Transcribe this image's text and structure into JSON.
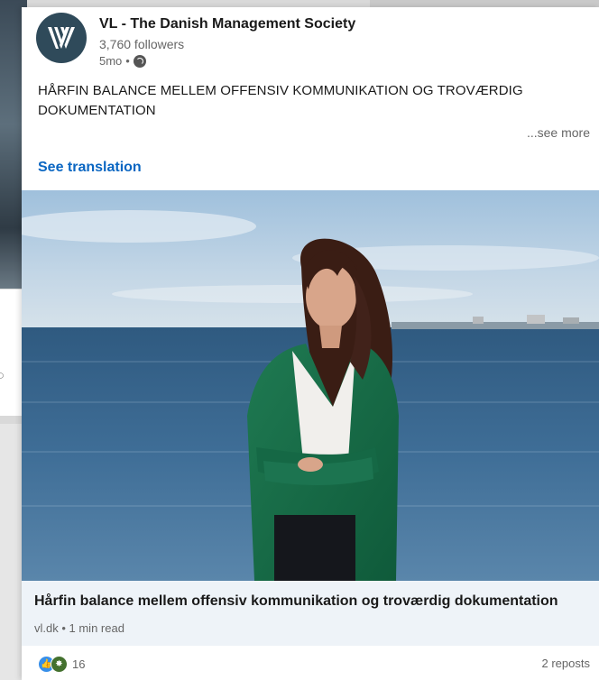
{
  "post": {
    "org_name": "VL - The Danish Management Society",
    "followers": "3,760 followers",
    "age": "5mo",
    "separator": "•",
    "text": "HÅRFIN BALANCE MELLEM OFFENSIV KOMMUNIKATION OG TROVÆRDIG DOKUMENTATION",
    "see_more": "...see more",
    "see_translation": "See translation",
    "visibility_icon": "globe-icon"
  },
  "link_preview": {
    "title": "Hårfin balance mellem offensiv kommunikation og troværdig dokumentation",
    "source": "vl.dk • 1 min read"
  },
  "social": {
    "reaction_icons": [
      "like-icon",
      "celebrate-icon"
    ],
    "reaction_count": "16",
    "reposts": "2 reposts"
  },
  "colors": {
    "accent": "#0a66c2",
    "avatar_bg": "#2f4a5a",
    "link_box_bg": "#eef3f8"
  }
}
